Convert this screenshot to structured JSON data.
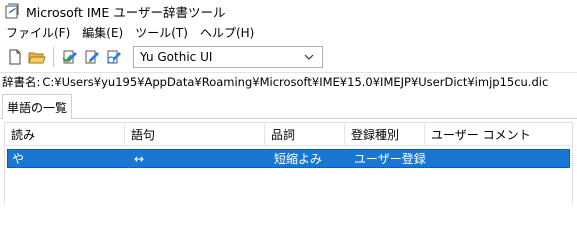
{
  "window": {
    "title": "Microsoft IME ユーザー辞書ツール",
    "icon": "dictionary-tool-icon"
  },
  "menu": {
    "items": [
      "ファイル(F)",
      "編集(E)",
      "ツール(T)",
      "ヘルプ(H)"
    ]
  },
  "toolbar": {
    "buttons": [
      "new-file-icon",
      "open-folder-icon",
      "edit-word-icon",
      "delete-word-icon",
      "merge-icon"
    ],
    "font_select": {
      "value": "Yu Gothic UI"
    }
  },
  "path": {
    "label": "辞書名:",
    "value": "C:¥Users¥yu195¥AppData¥Roaming¥Microsoft¥IME¥15.0¥IMEJP¥UserDict¥imjp15cu.dic"
  },
  "tabs": [
    {
      "label": "単語の一覧"
    }
  ],
  "list": {
    "columns": [
      "読み",
      "語句",
      "品詞",
      "登録種別",
      "ユーザー コメント"
    ],
    "rows": [
      {
        "reading": "や",
        "word": "↔",
        "pos": "短縮よみ",
        "type": "ユーザー登録",
        "comment": ""
      }
    ],
    "selected_row_color": "#1976d2"
  }
}
